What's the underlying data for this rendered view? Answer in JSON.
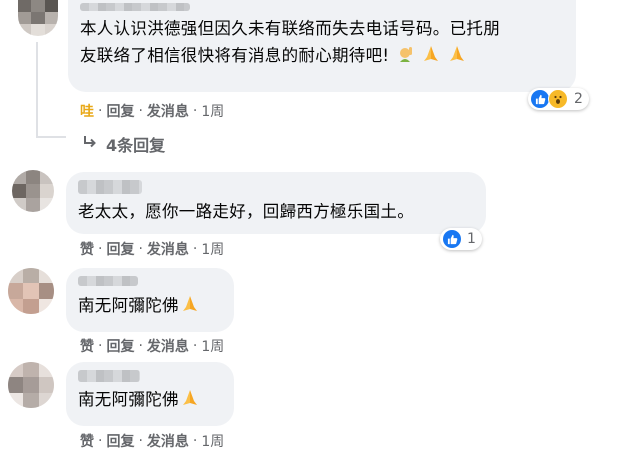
{
  "comments": [
    {
      "text_line1": "本人认识洪德强但因久未有联络而失去电话号码。已托朋",
      "text_line2": "友联络了相信很快将有消息的耐心期待吧!",
      "emojis": [
        "raising-hand-emoji",
        "folded-hands-emoji",
        "folded-hands-emoji"
      ],
      "actions": {
        "like": "哇",
        "reply": "回复",
        "message": "发消息",
        "time": "1周"
      },
      "reactions": {
        "types": [
          "like",
          "wow"
        ],
        "count": "2"
      },
      "replies": "4条回复"
    },
    {
      "text": "老太太，愿你一路走好，回歸西方極乐国土。",
      "actions": {
        "like": "赞",
        "reply": "回复",
        "message": "发消息",
        "time": "1周"
      },
      "reactions": {
        "types": [
          "like"
        ],
        "count": "1"
      }
    },
    {
      "text": "南无阿彌陀佛",
      "emojis": [
        "folded-hands-emoji"
      ],
      "actions": {
        "like": "赞",
        "reply": "回复",
        "message": "发消息",
        "time": "1周"
      }
    },
    {
      "text": "南无阿彌陀佛",
      "emojis": [
        "folded-hands-emoji"
      ],
      "actions": {
        "like": "赞",
        "reply": "回复",
        "message": "发消息",
        "time": "1周"
      }
    }
  ],
  "separator": "·",
  "colors": {
    "bubble": "#f0f2f5",
    "meta": "#65676b",
    "like_blue": "#1877f2",
    "wow_yellow": "#f7b928",
    "active_like": "#e8a817"
  }
}
